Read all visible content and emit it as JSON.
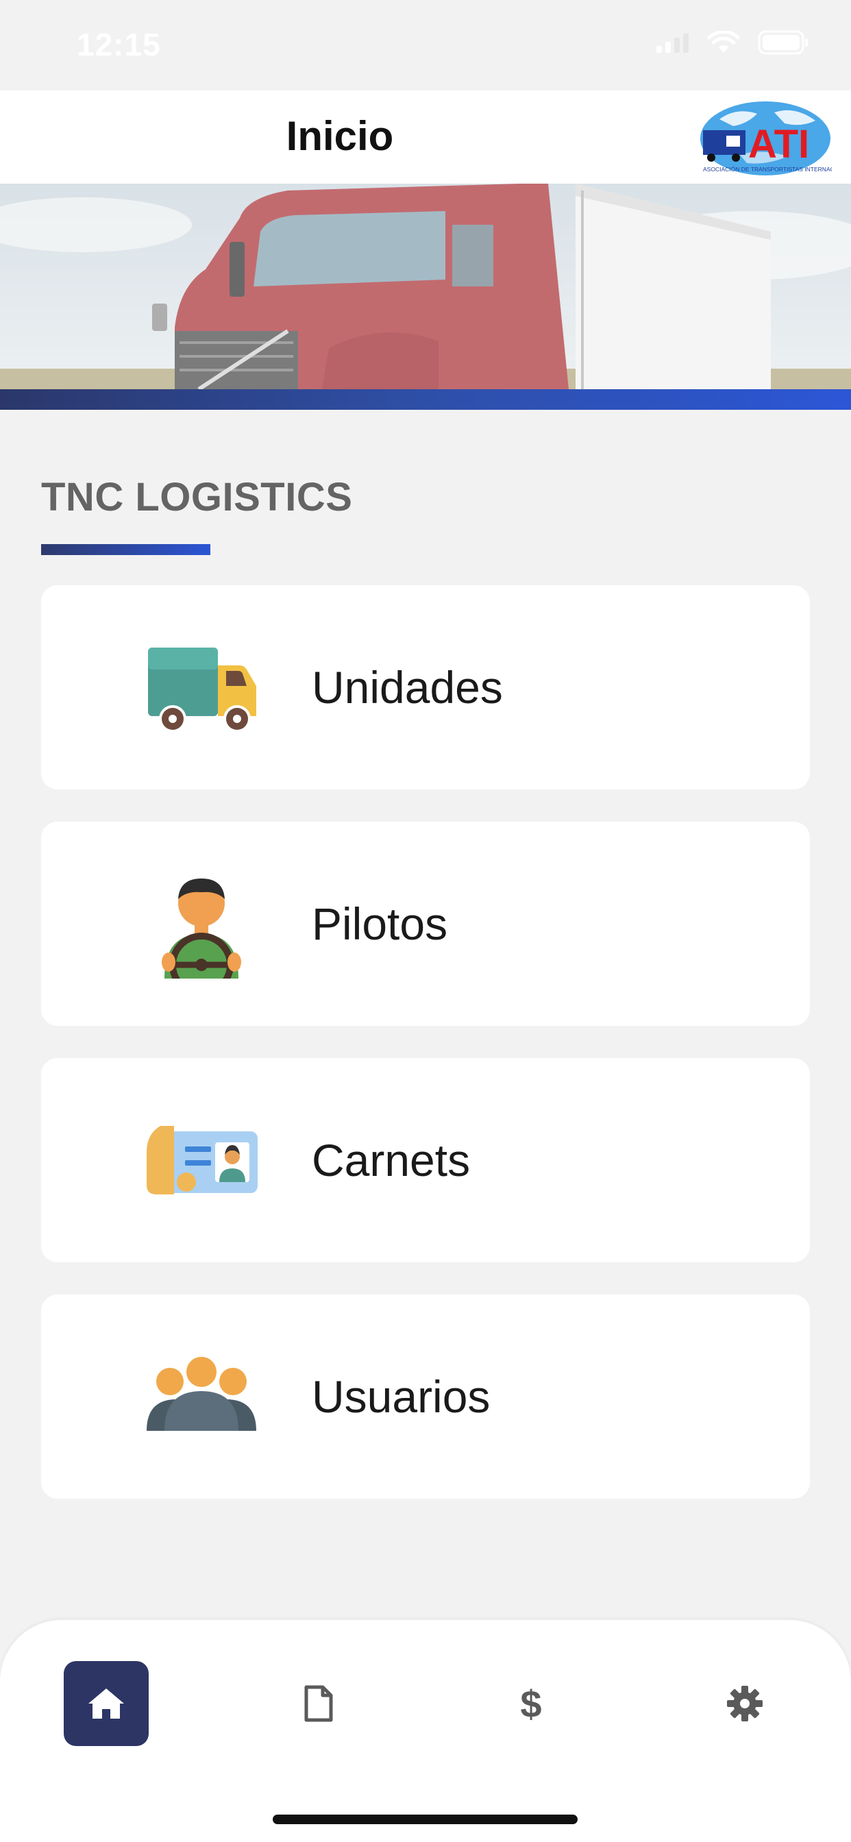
{
  "status_bar": {
    "time": "12:15"
  },
  "header": {
    "title": "Inicio",
    "logo_text": "ATI",
    "logo_subtitle": "ASOCIACIÓN DE TRANSPORTISTAS INTERNACIONALES"
  },
  "section": {
    "title": "TNC LOGISTICS"
  },
  "menu": [
    {
      "label": "Unidades",
      "icon": "truck-icon"
    },
    {
      "label": "Pilotos",
      "icon": "driver-icon"
    },
    {
      "label": "Carnets",
      "icon": "id-card-icon"
    },
    {
      "label": "Usuarios",
      "icon": "users-icon"
    }
  ],
  "bottom_nav": [
    {
      "icon": "home-icon",
      "active": true
    },
    {
      "icon": "document-icon",
      "active": false
    },
    {
      "icon": "dollar-icon",
      "active": false
    },
    {
      "icon": "gear-icon",
      "active": false
    }
  ],
  "colors": {
    "accent": "#2c3564",
    "stripe_end": "#2c56d6",
    "section_title": "#646464"
  }
}
